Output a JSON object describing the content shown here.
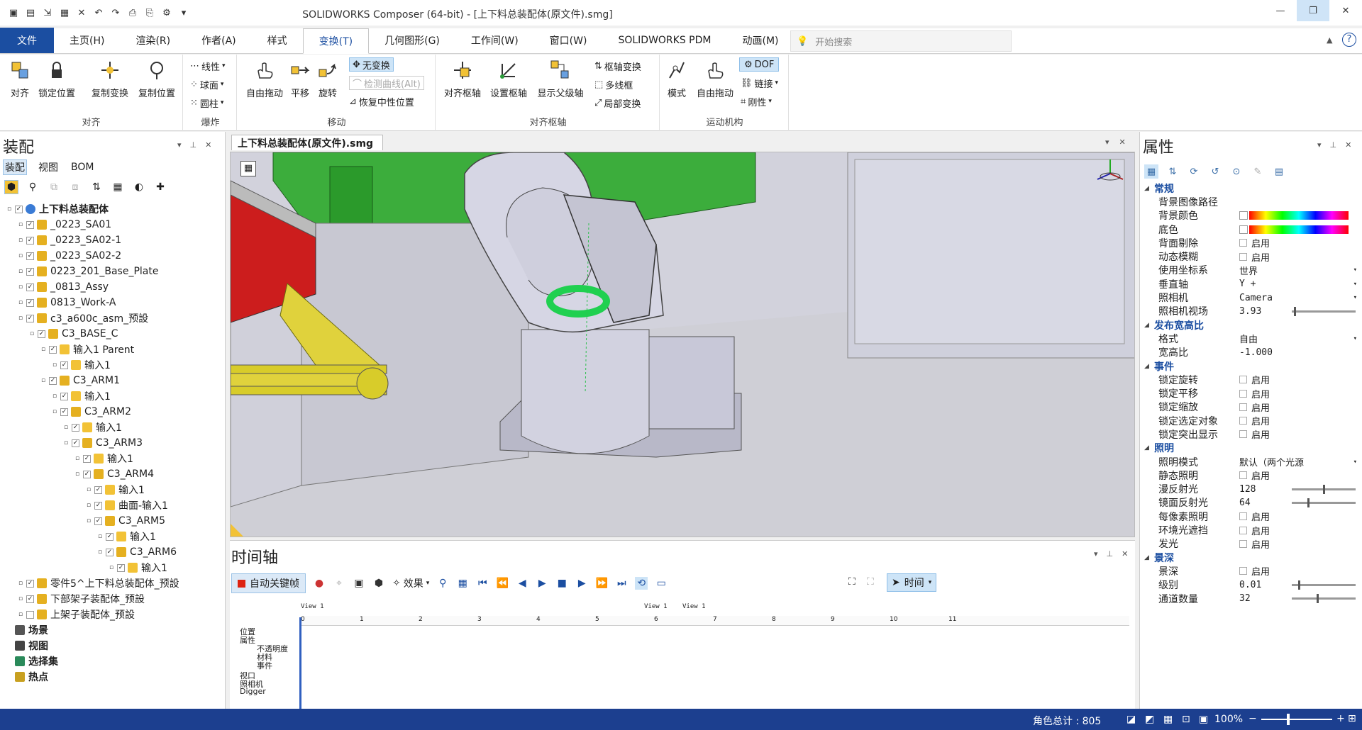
{
  "app": {
    "title": "SOLIDWORKS Composer (64-bit) - [上下料总装配体(原文件).smg]",
    "search_placeholder": "开始搜索"
  },
  "tabs": [
    {
      "label": "文件"
    },
    {
      "label": "主页(H)"
    },
    {
      "label": "渲染(R)"
    },
    {
      "label": "作者(A)"
    },
    {
      "label": "样式"
    },
    {
      "label": "变换(T)"
    },
    {
      "label": "几何图形(G)"
    },
    {
      "label": "工作间(W)"
    },
    {
      "label": "窗口(W)"
    },
    {
      "label": "SOLIDWORKS PDM"
    },
    {
      "label": "动画(M)"
    }
  ],
  "ribbon": {
    "align": {
      "group": "对齐",
      "btn1": "对齐",
      "btn2": "锁定位置",
      "btn3": "复制变换",
      "btn4": "复制位置"
    },
    "explode": {
      "group": "爆炸",
      "b1": "线性",
      "b2": "球面",
      "b3": "圆柱"
    },
    "move": {
      "group": "移动",
      "b1": "自由拖动",
      "b2": "平移",
      "b3": "旋转",
      "s1": "无变换",
      "s2": "检测曲线(Alt)",
      "s3": "恢复中性位置"
    },
    "pivot": {
      "group": "对齐枢轴",
      "b1": "对齐枢轴",
      "b2": "设置枢轴",
      "b3": "显示父级轴",
      "s1": "枢轴变换",
      "s2": "多线框",
      "s3": "局部变换"
    },
    "mech": {
      "group": "运动机构",
      "b1": "模式",
      "b2": "自由拖动",
      "s1": "DOF",
      "s2": "链接",
      "s3": "刚性"
    }
  },
  "left_panel": {
    "title": "装配",
    "subtabs": [
      "装配",
      "视图",
      "BOM"
    ],
    "tree": [
      {
        "label": "上下料总装配体",
        "bold": true
      },
      {
        "label": "_0223_SA01"
      },
      {
        "label": "_0223_SA02-1"
      },
      {
        "label": "_0223_SA02-2"
      },
      {
        "label": "0223_201_Base_Plate"
      },
      {
        "label": "_0813_Assy"
      },
      {
        "label": "0813_Work-A"
      },
      {
        "label": "c3_a600c_asm_预設"
      },
      {
        "label": "C3_BASE_C"
      },
      {
        "label": "输入1 Parent"
      },
      {
        "label": "输入1"
      },
      {
        "label": "C3_ARM1"
      },
      {
        "label": "输入1"
      },
      {
        "label": "C3_ARM2"
      },
      {
        "label": "输入1"
      },
      {
        "label": "C3_ARM3"
      },
      {
        "label": "输入1"
      },
      {
        "label": "C3_ARM4"
      },
      {
        "label": "输入1"
      },
      {
        "label": "曲面-输入1"
      },
      {
        "label": "C3_ARM5"
      },
      {
        "label": "输入1"
      },
      {
        "label": "C3_ARM6"
      },
      {
        "label": "输入1"
      },
      {
        "label": "零件5^上下料总装配体_预設"
      },
      {
        "label": "下部架子装配体_预設"
      },
      {
        "label": "上架子装配体_预設"
      },
      {
        "label": "场景",
        "bold": true
      },
      {
        "label": "视图",
        "bold": true
      },
      {
        "label": "选择集",
        "bold": true
      },
      {
        "label": "热点",
        "bold": true
      }
    ]
  },
  "viewport": {
    "tab": "上下料总装配体(原文件).smg"
  },
  "timeline": {
    "title": "时间轴",
    "autokey": "自动关键帧",
    "effects": "效果",
    "time_mode": "时间",
    "markers": [
      "View 1",
      "View 1",
      "View 1"
    ],
    "ticks": [
      "0",
      "1",
      "2",
      "3",
      "4",
      "5",
      "6",
      "7",
      "8",
      "9",
      "10",
      "11"
    ],
    "rows": [
      "位置",
      "属性",
      "不透明度",
      "材料",
      "事件",
      "视口",
      "照相机",
      "Digger"
    ]
  },
  "right_panel": {
    "title": "属性",
    "rows": [
      {
        "k": "常规",
        "sec": true
      },
      {
        "k": "背景图像路径",
        "v": ""
      },
      {
        "k": "背景颜色",
        "v": "",
        "color": true
      },
      {
        "k": "底色",
        "v": "",
        "color": true
      },
      {
        "k": "背面剔除",
        "v": "启用",
        "chk": true
      },
      {
        "k": "动态模糊",
        "v": "启用",
        "chk": true
      },
      {
        "k": "使用坐标系",
        "v": "世界",
        "dd": true
      },
      {
        "k": "垂直轴",
        "v": "Y +",
        "dd": true
      },
      {
        "k": "照相机",
        "v": "Camera",
        "dd": true
      },
      {
        "k": "照相机视场",
        "v": "3.93",
        "slider": 0.03
      },
      {
        "k": "发布宽高比",
        "sec": true
      },
      {
        "k": "格式",
        "v": "自由",
        "dd": true
      },
      {
        "k": "宽高比",
        "v": "-1.000"
      },
      {
        "k": "事件",
        "sec": true
      },
      {
        "k": "锁定旋转",
        "v": "启用",
        "chk": true
      },
      {
        "k": "锁定平移",
        "v": "启用",
        "chk": true
      },
      {
        "k": "锁定缩放",
        "v": "启用",
        "chk": true
      },
      {
        "k": "锁定选定对象",
        "v": "启用",
        "chk": true
      },
      {
        "k": "锁定突出显示",
        "v": "启用",
        "chk": true
      },
      {
        "k": "照明",
        "sec": true
      },
      {
        "k": "照明模式",
        "v": "默认（两个光源",
        "dd": true
      },
      {
        "k": "静态照明",
        "v": "启用",
        "chk": true
      },
      {
        "k": "漫反射光",
        "v": "128",
        "slider": 0.5
      },
      {
        "k": "镜面反射光",
        "v": "64",
        "slider": 0.25
      },
      {
        "k": "每像素照明",
        "v": "启用",
        "chk": true
      },
      {
        "k": "环境光遮挡",
        "v": "启用",
        "chk": true
      },
      {
        "k": "发光",
        "v": "启用",
        "chk": true
      },
      {
        "k": "景深",
        "sec": true
      },
      {
        "k": "景深",
        "v": "启用",
        "chk": true
      },
      {
        "k": "级别",
        "v": "0.01",
        "slider": 0.1
      },
      {
        "k": "通道数量",
        "v": "32",
        "slider": 0.4
      }
    ]
  },
  "status": {
    "count": "角色总计 : 805",
    "zoom": "100%"
  }
}
